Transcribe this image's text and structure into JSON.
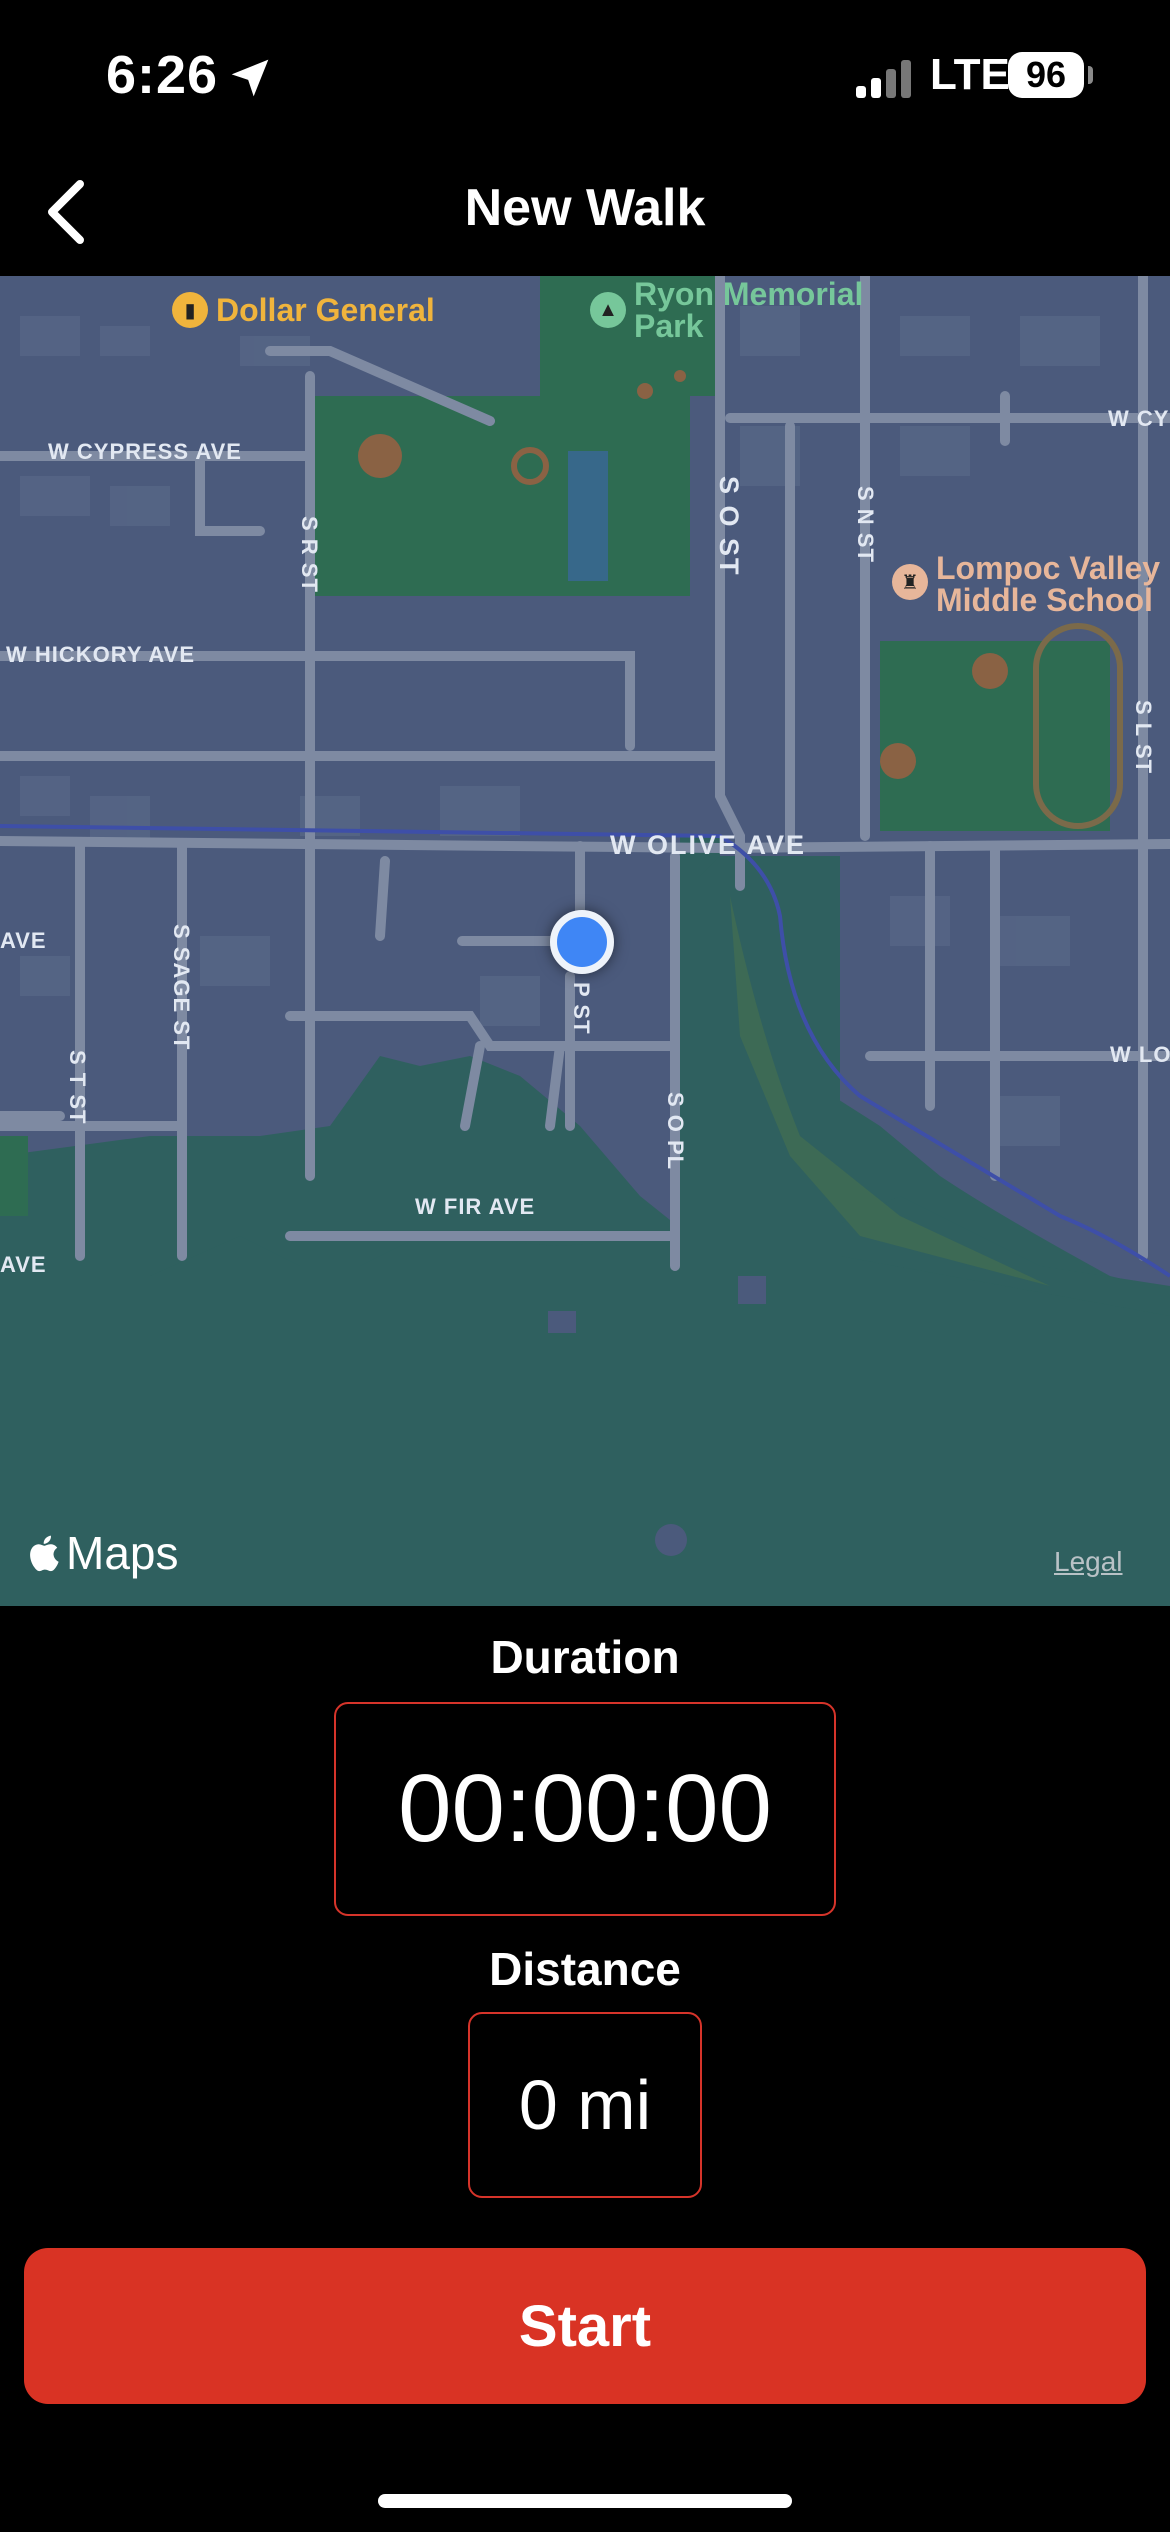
{
  "status_bar": {
    "time": "6:26",
    "network": "LTE",
    "battery": "96"
  },
  "nav": {
    "title": "New Walk",
    "back_icon": "chevron-left-icon"
  },
  "map": {
    "roads": {
      "cypress": "W CYPRESS AVE",
      "cypress_right": "W CY",
      "hickory": "W HICKORY AVE",
      "olive": "W OLIVE AVE",
      "fir": "W FIR AVE",
      "r_st": "S R ST",
      "o_st": "S O ST",
      "n_st": "S N ST",
      "l_st": "S L ST",
      "sage_st": "S SAGE ST",
      "t_st": "S T ST",
      "p_st": "P ST",
      "o_pl": "S O PL",
      "ave_left_1": "AVE",
      "ave_left_2": "AVE",
      "lo_right": "W LO"
    },
    "pois": {
      "dollar_general": "Dollar General",
      "ryon_park_1": "Ryon Memorial",
      "ryon_park_2": "Park",
      "lompoc_1": "Lompoc Valley",
      "lompoc_2": "Middle School"
    },
    "colors": {
      "poi_shop": "#f0b43c",
      "poi_park": "#76c79a",
      "poi_school": "#e7b69a"
    },
    "attribution": "Maps",
    "legal": "Legal"
  },
  "stats": {
    "duration_label": "Duration",
    "duration_value": "00:00:00",
    "distance_label": "Distance",
    "distance_value": "0 mi"
  },
  "actions": {
    "start_label": "Start",
    "accent_color": "#d93324"
  }
}
